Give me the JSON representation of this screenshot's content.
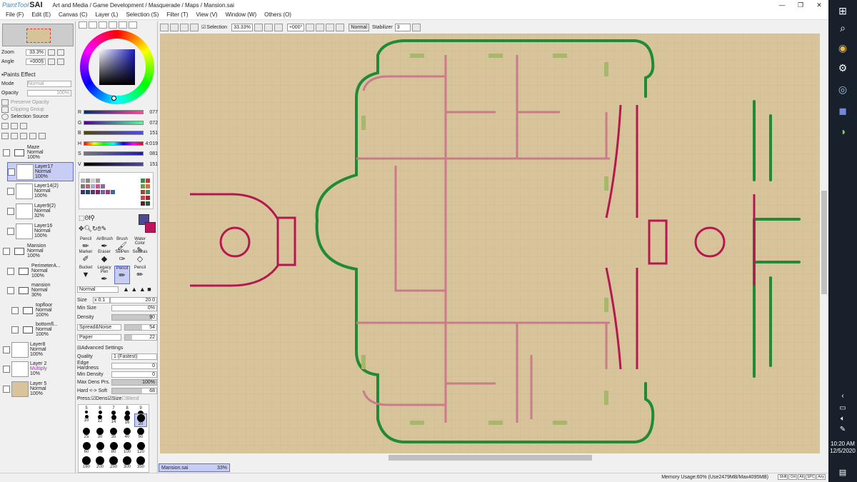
{
  "app": {
    "logo_text": "PaintTool",
    "logo_brand": "SAI",
    "title": "Art and Media / Game Development / Masquerade / Maps / Mansion.sai",
    "win_min": "—",
    "win_max": "❐",
    "win_close": "✕"
  },
  "menu": [
    "File (F)",
    "Edit (E)",
    "Canvas (C)",
    "Layer (L)",
    "Selection (S)",
    "Filter (T)",
    "View (V)",
    "Window (W)",
    "Others (O)"
  ],
  "navigator": {
    "zoom_label": "Zoom",
    "zoom_value": "33.3%",
    "angle_label": "Angle",
    "angle_value": "+000§"
  },
  "effects": {
    "title": "Paints Effect",
    "mode_label": "Mode",
    "mode_value": "Normal",
    "opacity_label": "Opacity",
    "opacity_value": "100%",
    "preserve_opacity": "Preserve Opacity",
    "clipping_group": "Clipping Group",
    "selection_source": "Selection Source"
  },
  "layers": [
    {
      "name": "Maze",
      "mode": "Normal",
      "opacity": "100%",
      "folder": true
    },
    {
      "name": "Layer17",
      "mode": "Normal",
      "opacity": "100%",
      "selected": true
    },
    {
      "name": "Layer14(2)",
      "mode": "Normal",
      "opacity": "100%"
    },
    {
      "name": "Layer9(2)",
      "mode": "Normal",
      "opacity": "32%"
    },
    {
      "name": "Layer16",
      "mode": "Normal",
      "opacity": "100%"
    },
    {
      "name": "Mansion",
      "mode": "Normal",
      "opacity": "100%",
      "folder": true
    },
    {
      "name": "PerimeterA...",
      "mode": "Normal",
      "opacity": "100%"
    },
    {
      "name": "mansion",
      "mode": "Normal",
      "opacity": "30%",
      "folder": true
    },
    {
      "name": "topfloor",
      "mode": "Normal",
      "opacity": "100%",
      "folder": true
    },
    {
      "name": "bottomfl...",
      "mode": "Normal",
      "opacity": "100%",
      "folder": true
    },
    {
      "name": "Layer8",
      "mode": "Normal",
      "opacity": "100%"
    },
    {
      "name": "Layer 2",
      "mode": "Multiply",
      "opacity": "10%"
    },
    {
      "name": "Layer 5",
      "mode": "Normal",
      "opacity": "100%"
    }
  ],
  "color": {
    "current": "#4d4899",
    "secondary": "#c0155a",
    "sliders": [
      {
        "label": "R",
        "value": "077"
      },
      {
        "label": "G",
        "value": "072"
      },
      {
        "label": "B",
        "value": "151"
      },
      {
        "label": "H",
        "value": "4:019"
      },
      {
        "label": "S",
        "value": "081"
      },
      {
        "label": "V",
        "value": "151"
      }
    ]
  },
  "tools": [
    "Pencil",
    "AirBrush",
    "Brush",
    "Water Color",
    "Marker",
    "Eraser",
    "SelPen",
    "SelEras",
    "Bucket",
    "Legacy Pen",
    "Pencil",
    "Pencil"
  ],
  "brush": {
    "mode": "Normal",
    "size_label": "Size",
    "size_mult": "x 0.1",
    "size_value": "20.0",
    "minsize_label": "Min Size",
    "minsize_value": "0%",
    "density_label": "Density",
    "density_value": "90",
    "texture": "Spread&Noise",
    "texture_value": "54",
    "paper": "Paper",
    "paper_value": "22",
    "advanced": "Advanced Settings",
    "quality_label": "Quality",
    "quality_value": "1 (Fastest)",
    "edge_label": "Edge Hardness",
    "edge_value": "0",
    "mindens_label": "Min Density",
    "mindens_value": "0",
    "maxdens_label": "Max Dens Prs.",
    "maxdens_value": "100%",
    "hardsoft_label": "Hard <-> Soft",
    "hardsoft_value": "68",
    "press_label": "Press:",
    "press_dens": "Dens",
    "press_size": "Size",
    "press_blend": "Blend"
  },
  "brush_sizes": [
    "5",
    "6",
    "7",
    "8",
    "9",
    "10",
    "12",
    "14",
    "16",
    "20",
    "25",
    "30",
    "35",
    "40",
    "50",
    "60",
    "70",
    "80",
    "100",
    "120",
    "160",
    "200",
    "250",
    "300",
    "350"
  ],
  "toolbar": {
    "selection": "Selection",
    "zoom": "33.33%",
    "angle": "+000°",
    "mode": "Normal",
    "stabilizer_label": "Stabilizer",
    "stabilizer_value": "3"
  },
  "file_tab": {
    "name": "Mansion.sai",
    "zoom": "33%"
  },
  "status": {
    "memory": "Memory Usage:60% (Use2479MB/Max4095MB)",
    "keys": [
      "Shift",
      "Ctrl",
      "Alt",
      "SPC",
      "Any"
    ]
  },
  "taskbar": {
    "time": "10:20 AM",
    "date": "12/5/2020"
  }
}
